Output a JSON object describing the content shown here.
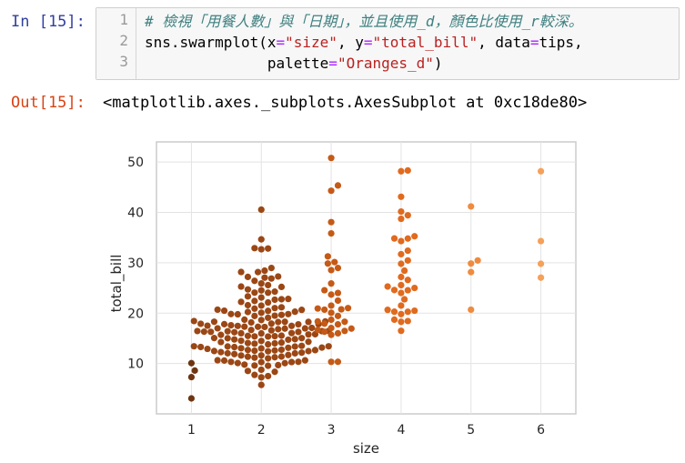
{
  "input_cell": {
    "prompt": "In [15]:",
    "line_numbers": [
      "1",
      "2",
      "3"
    ],
    "lines": [
      [
        {
          "cls": "cm-comment",
          "text": "# 檢視「用餐人數」與「日期」，並且使用_d，顏色比使用_r較深。"
        }
      ],
      [
        {
          "cls": "cm-var",
          "text": "sns.swarmplot(x"
        },
        {
          "cls": "cm-op",
          "text": "="
        },
        {
          "cls": "cm-string",
          "text": "\"size\""
        },
        {
          "cls": "cm-var",
          "text": ", y"
        },
        {
          "cls": "cm-op",
          "text": "="
        },
        {
          "cls": "cm-string",
          "text": "\"total_bill\""
        },
        {
          "cls": "cm-var",
          "text": ", data"
        },
        {
          "cls": "cm-op",
          "text": "="
        },
        {
          "cls": "cm-var",
          "text": "tips,"
        }
      ],
      [
        {
          "cls": "cm-var",
          "text": "              palette"
        },
        {
          "cls": "cm-op",
          "text": "="
        },
        {
          "cls": "cm-string",
          "text": "\"Oranges_d\""
        },
        {
          "cls": "cm-var",
          "text": ")"
        }
      ]
    ]
  },
  "output_cell": {
    "prompt": "Out[15]:",
    "text": "<matplotlib.axes._subplots.AxesSubplot at 0xc18de80>"
  },
  "chart_data": {
    "type": "scatter",
    "subtype": "swarm",
    "xlabel": "size",
    "ylabel": "total_bill",
    "categories": [
      "1",
      "2",
      "3",
      "4",
      "5",
      "6"
    ],
    "yticks": [
      10,
      20,
      30,
      40,
      50
    ],
    "ylim": [
      0,
      54
    ],
    "grid": true,
    "colors": [
      "#6e3512",
      "#9b4715",
      "#c55a16",
      "#e06a1e",
      "#ef8b3e",
      "#f6a058"
    ],
    "series": [
      {
        "category": "1",
        "values": [
          3.07,
          7.3,
          8.6,
          10.07
        ]
      },
      {
        "category": "2",
        "values": [
          5.75,
          7.25,
          7.51,
          7.74,
          8.35,
          8.52,
          8.77,
          9.55,
          9.6,
          9.68,
          9.78,
          10.07,
          10.09,
          10.27,
          10.29,
          10.33,
          10.34,
          10.59,
          10.63,
          10.65,
          11.02,
          11.17,
          11.24,
          11.35,
          11.38,
          11.59,
          11.61,
          11.69,
          11.87,
          12.02,
          12.03,
          12.16,
          12.26,
          12.43,
          12.46,
          12.48,
          12.54,
          12.6,
          12.66,
          12.69,
          12.74,
          12.9,
          13.0,
          13.03,
          13.13,
          13.16,
          13.27,
          13.28,
          13.37,
          13.39,
          13.42,
          13.42,
          13.51,
          13.81,
          13.94,
          14.0,
          14.07,
          14.15,
          14.26,
          14.31,
          14.48,
          14.52,
          14.73,
          14.78,
          14.83,
          15.01,
          15.04,
          15.06,
          15.36,
          15.38,
          15.42,
          15.48,
          15.53,
          15.69,
          15.77,
          15.81,
          15.98,
          16.0,
          16.04,
          16.21,
          16.27,
          16.29,
          16.32,
          16.4,
          16.43,
          16.45,
          16.47,
          16.58,
          16.66,
          16.82,
          16.93,
          16.97,
          16.99,
          17.07,
          17.26,
          17.29,
          17.31,
          17.46,
          17.47,
          17.51,
          17.59,
          17.78,
          17.81,
          17.82,
          17.89,
          17.92,
          18.15,
          18.24,
          18.26,
          18.28,
          18.29,
          18.35,
          18.43,
          18.64,
          18.71,
          19.08,
          19.44,
          19.49,
          19.65,
          19.77,
          19.82,
          19.81,
          20.08,
          20.23,
          20.29,
          20.45,
          20.49,
          20.65,
          20.69,
          20.9,
          21.01,
          21.16,
          21.5,
          21.58,
          22.12,
          22.23,
          22.42,
          22.67,
          22.76,
          22.82,
          23.1,
          23.33,
          24.06,
          24.08,
          24.27,
          24.52,
          24.71,
          25.21,
          25.28,
          25.56,
          25.89,
          26.41,
          26.88,
          27.05,
          27.2,
          27.28,
          28.15,
          28.17,
          28.44,
          28.97,
          32.68,
          32.9,
          32.83,
          34.65,
          40.55
        ]
      },
      {
        "category": "3",
        "values": [
          10.34,
          10.33,
          15.69,
          16.0,
          16.31,
          16.47,
          16.66,
          16.93,
          17.06,
          17.78,
          17.92,
          18.29,
          18.35,
          18.69,
          19.44,
          20.08,
          20.69,
          20.76,
          20.92,
          21.01,
          21.5,
          22.49,
          23.68,
          24.01,
          24.55,
          25.89,
          28.55,
          28.97,
          29.85,
          30.14,
          31.27,
          35.83,
          38.07,
          44.3,
          45.35,
          50.81
        ]
      },
      {
        "category": "4",
        "values": [
          16.49,
          18.28,
          18.43,
          18.71,
          19.81,
          20.27,
          20.29,
          20.49,
          20.65,
          21.5,
          22.75,
          24.01,
          24.55,
          24.59,
          25.0,
          25.29,
          25.56,
          26.59,
          27.18,
          28.44,
          29.8,
          30.46,
          31.71,
          32.4,
          34.3,
          34.81,
          34.83,
          35.26,
          38.73,
          39.42,
          40.17,
          43.11,
          48.17,
          48.33
        ]
      },
      {
        "category": "5",
        "values": [
          20.69,
          28.15,
          29.85,
          30.46,
          41.19
        ]
      },
      {
        "category": "6",
        "values": [
          27.05,
          29.8,
          34.3,
          48.17
        ]
      }
    ]
  }
}
